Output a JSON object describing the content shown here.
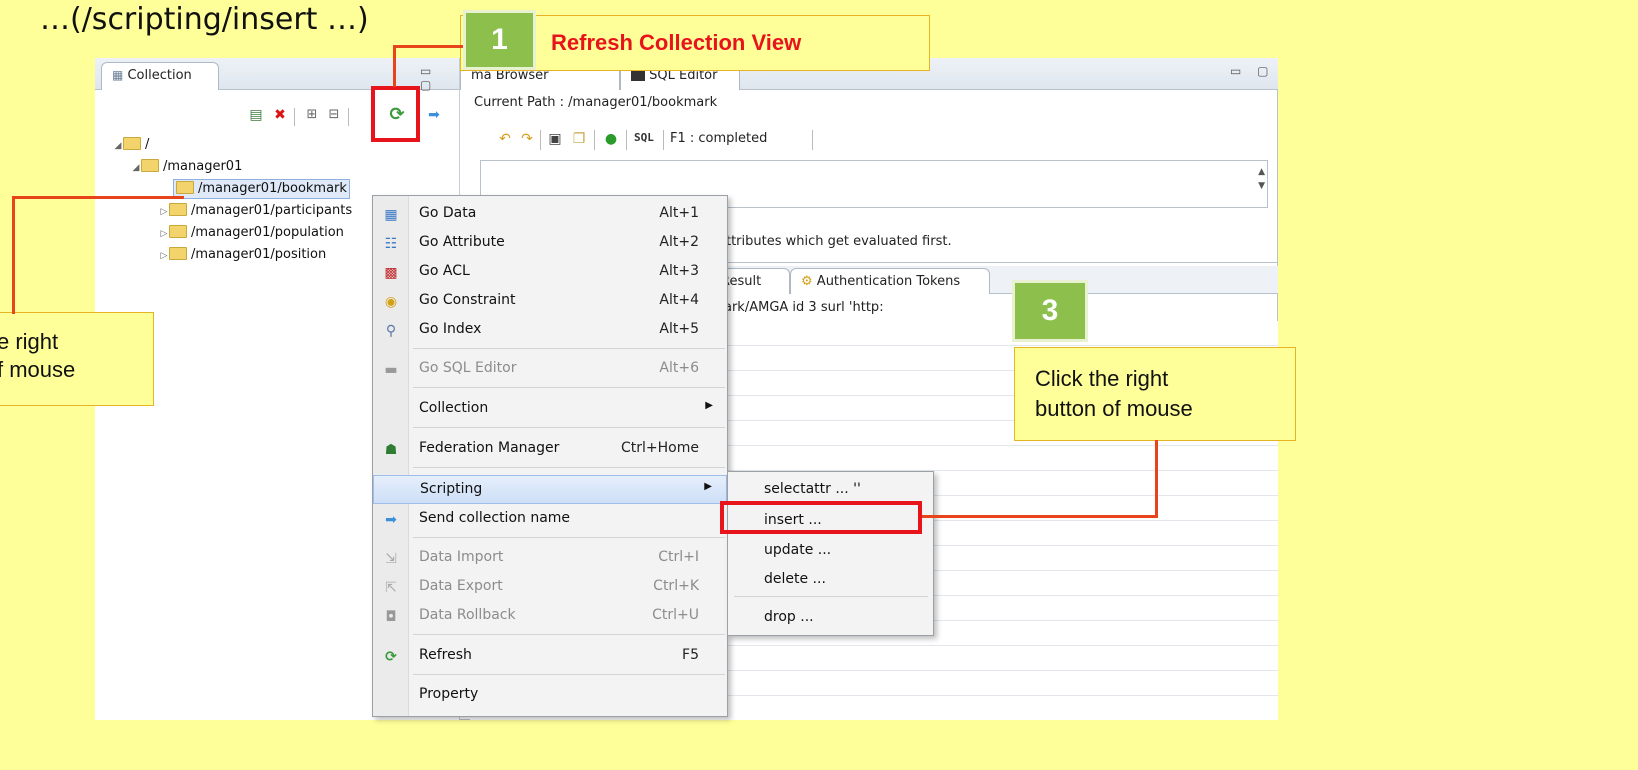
{
  "slide": {
    "title": "…(/scripting/insert …)"
  },
  "left_panel": {
    "tab_label": "Collection",
    "window_controls": "▭ ▢",
    "tree": [
      {
        "label": "/",
        "level": 0,
        "expanded": true
      },
      {
        "label": "/manager01",
        "level": 1,
        "expanded": true
      },
      {
        "label": "/manager01/bookmark",
        "level": 2,
        "selected": true
      },
      {
        "label": "/manager01/participants",
        "level": 2
      },
      {
        "label": "/manager01/population",
        "level": 2
      },
      {
        "label": "/manager01/position",
        "level": 2
      }
    ]
  },
  "right_panel": {
    "tabs": [
      "ma Browser",
      "SQL Editor"
    ],
    "window_controls": "▭ ▢",
    "current_path_label": "Current Path :",
    "current_path_value": "/manager01/bookmark",
    "sql_label": "SQL",
    "status": "F1 : completed",
    "info_text": "attributes which get evaluated first.",
    "result_tabs": [
      "Result",
      "Authentication Tokens"
    ],
    "result_row": "ark/AMGA  id 3 surl 'http:"
  },
  "context_menu": {
    "items": [
      {
        "label": "Go Data",
        "shortcut": "Alt+1",
        "icon": "grid-icon"
      },
      {
        "label": "Go Attribute",
        "shortcut": "Alt+2",
        "icon": "attribute-icon"
      },
      {
        "label": "Go ACL",
        "shortcut": "Alt+3",
        "icon": "acl-icon"
      },
      {
        "label": "Go Constraint",
        "shortcut": "Alt+4",
        "icon": "constraint-icon"
      },
      {
        "label": "Go Index",
        "shortcut": "Alt+5",
        "icon": "index-icon"
      },
      {
        "label": "Go SQL Editor",
        "shortcut": "Alt+6",
        "icon": "sql-editor-icon",
        "disabled": true
      },
      {
        "label": "Collection",
        "shortcut": "",
        "submenu": true
      },
      {
        "label": "Federation Manager",
        "shortcut": "Ctrl+Home",
        "icon": "federation-icon"
      },
      {
        "label": "Scripting",
        "shortcut": "",
        "submenu": true,
        "highlighted": true
      },
      {
        "label": "Send collection name",
        "shortcut": "",
        "icon": "send-icon"
      },
      {
        "label": "Data Import",
        "shortcut": "Ctrl+I",
        "icon": "import-icon",
        "disabled": true
      },
      {
        "label": "Data Export",
        "shortcut": "Ctrl+K",
        "icon": "export-icon",
        "disabled": true
      },
      {
        "label": "Data Rollback",
        "shortcut": "Ctrl+U",
        "icon": "rollback-icon",
        "disabled": true
      },
      {
        "label": "Refresh",
        "shortcut": "F5",
        "icon": "refresh-icon"
      },
      {
        "label": "Property",
        "shortcut": ""
      }
    ]
  },
  "scripting_submenu": {
    "items": [
      "selectattr ... ''",
      "insert ...",
      "update ...",
      "delete ...",
      "drop ..."
    ]
  },
  "annotations": {
    "step1_number": "1",
    "step1_label": "Refresh Collection View",
    "step2_text_line1": "e right",
    "step2_text_line2": "f mouse",
    "step3_number": "3",
    "step3_text_line1": "Click the right",
    "step3_text_line2": "button of mouse"
  },
  "colors": {
    "background": "#ffff99",
    "highlight_red": "#e8141c",
    "badge_green": "#8dbf4d",
    "step1_label_red": "#e8141c"
  }
}
